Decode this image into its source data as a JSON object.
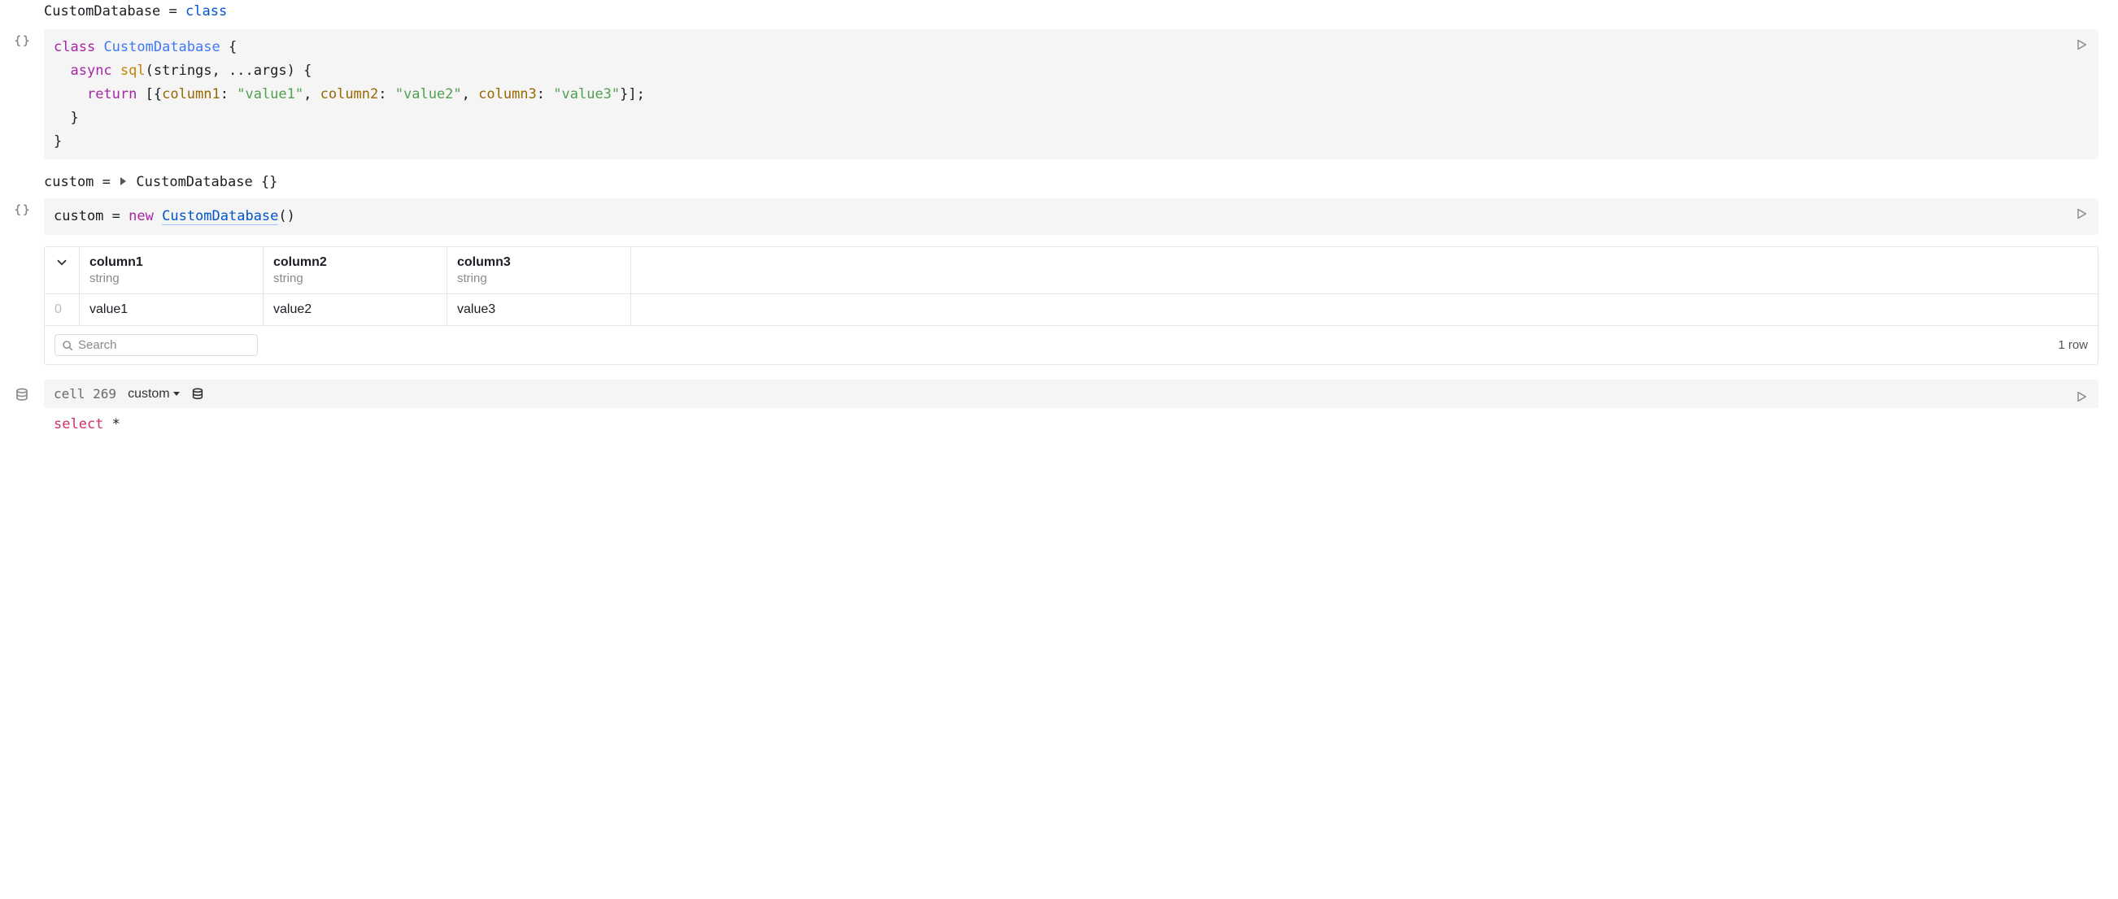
{
  "cell1": {
    "output_lhs": "CustomDatabase",
    "output_eq": " = ",
    "output_rhs": "class",
    "code": {
      "l1_kw": "class",
      "l1_name": "CustomDatabase",
      "l1_brace": " {",
      "l2_indent": "  ",
      "l2_kw": "async",
      "l2_fn": "sql",
      "l2_params": "(strings, ...args) {",
      "l3_indent": "    ",
      "l3_kw": "return",
      "l3_open": " [{",
      "l3_p1": "column1",
      "l3_c": ": ",
      "l3_v1": "\"value1\"",
      "l3_s": ", ",
      "l3_p2": "column2",
      "l3_v2": "\"value2\"",
      "l3_p3": "column3",
      "l3_v3": "\"value3\"",
      "l3_close": "}];",
      "l4": "  }",
      "l5": "}"
    }
  },
  "cell2": {
    "output_lhs": "custom",
    "output_eq": " = ",
    "output_rhs_name": "CustomDatabase",
    "output_rhs_rest": " {}",
    "code_lhs": "custom",
    "code_eq": " = ",
    "code_new": "new",
    "code_sp": " ",
    "code_class": "CustomDatabase",
    "code_parens": "()"
  },
  "table": {
    "columns": [
      {
        "name": "column1",
        "type": "string"
      },
      {
        "name": "column2",
        "type": "string"
      },
      {
        "name": "column3",
        "type": "string"
      }
    ],
    "rows": [
      {
        "idx": "0",
        "cells": [
          "value1",
          "value2",
          "value3"
        ]
      }
    ],
    "search_placeholder": "Search",
    "row_count_label": "1 row"
  },
  "sql_cell": {
    "cell_label": "cell 269",
    "db_name": "custom",
    "query_kw": "select",
    "query_rest": " *"
  }
}
